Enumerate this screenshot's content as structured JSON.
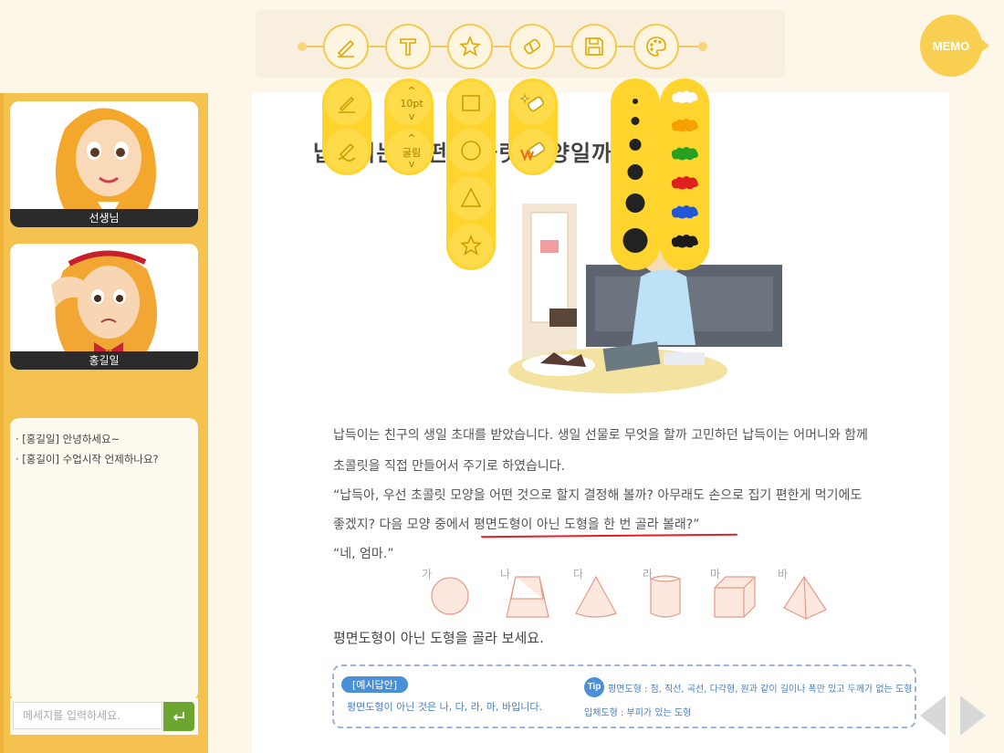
{
  "toolbar": {
    "tools": [
      "pen-icon",
      "text-icon",
      "star-icon",
      "eraser-icon",
      "save-icon",
      "palette-icon"
    ],
    "memo_label": "MEMO"
  },
  "pen_options": [
    "pen-thin-icon",
    "pen-freehand-icon"
  ],
  "text_options": {
    "size_label": "10pt",
    "style_label": "굴림"
  },
  "shape_options": [
    "rectangle-icon",
    "circle-icon",
    "triangle-icon",
    "star-icon"
  ],
  "eraser_options": [
    "eraser-sparkle-icon",
    "eraser-clear-icon"
  ],
  "thickness_options": [
    "xs",
    "s",
    "m",
    "l",
    "xl",
    "xxl"
  ],
  "color_options": [
    "#ffffff",
    "#f5a200",
    "#2aa023",
    "#e01f1f",
    "#2058d8",
    "#1a1a1a"
  ],
  "participants": [
    {
      "name": "선생님"
    },
    {
      "name": "홍길일"
    }
  ],
  "chat": {
    "messages": [
      "· [홍길일] 안녕하세요~",
      "· [홍길이] 수업시작 언제하나요?"
    ],
    "input_placeholder": "메세지를 입력하세요."
  },
  "document": {
    "title": "납득이는 어떤 초콜릿 모양일까요?",
    "paragraphs": [
      "납득이는 친구의 생일 초대를 받았습니다. 생일 선물로 무엇을 할까 고민하던 납득이는 어머니와 함께",
      "초콜릿을 직접 만들어서 주기로 하였습니다.",
      "“납득아, 우선 초콜릿 모양을 어떤 것으로 할지 결정해 볼까? 아무래도 손으로 집기 편한게 먹기에도",
      "좋겠지? 다음 모양 중에서 평면도형이 아닌 도형을 한 번 골라 볼래?”",
      "“네, 엄마.”"
    ],
    "shape_labels": [
      "가",
      "나",
      "다",
      "라",
      "마",
      "바"
    ],
    "question": "평면도형이 아닌 도형을 골라 보세요.",
    "answer_badge": "[예시답안]",
    "answer_text": "평면도형이 아닌 것은 나, 다, 라, 마, 바입니다.",
    "tip_label": "Tip",
    "tip_line1": "평면도형 : 점, 직선, 곡선, 다각형, 원과 같이 길이나 폭만 있고 두께가 없는 도형",
    "tip_line2": "입체도형 : 부피가 있는 도형"
  }
}
